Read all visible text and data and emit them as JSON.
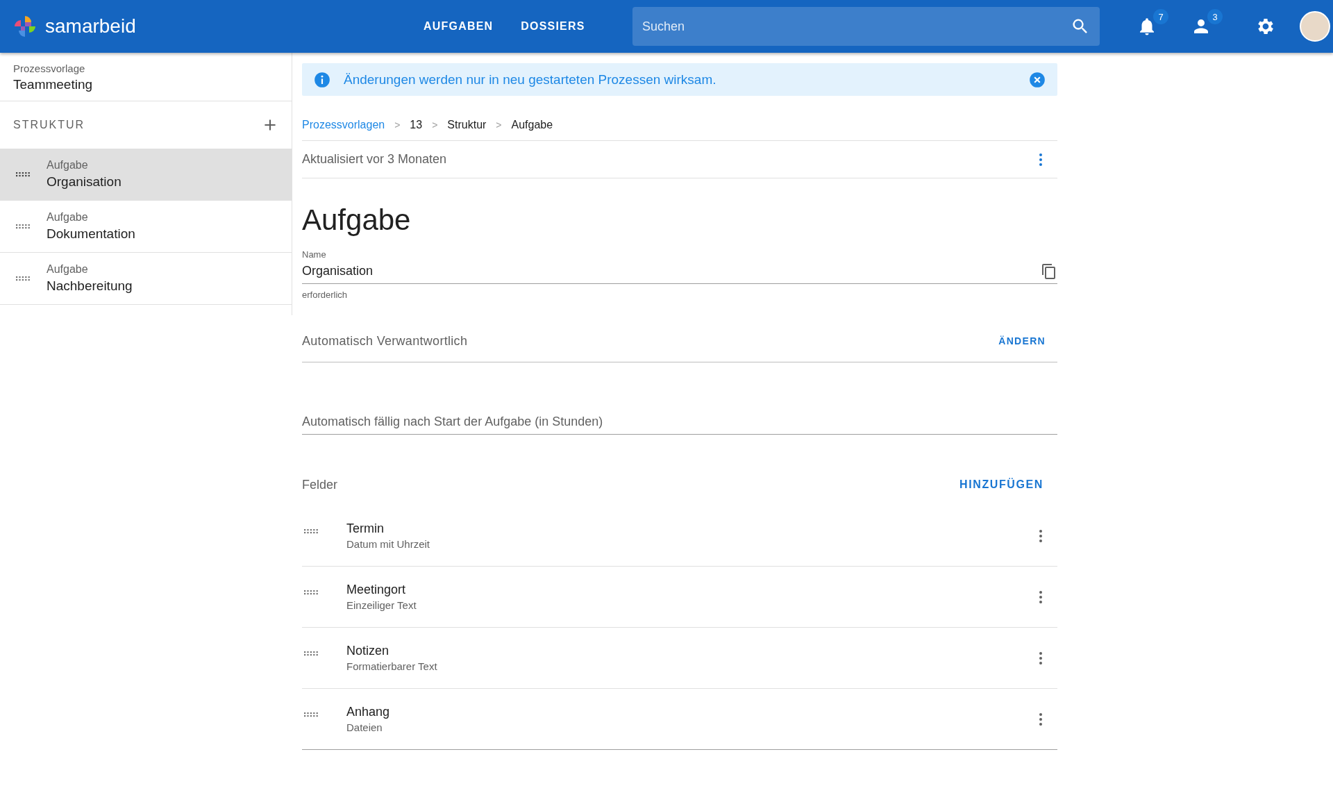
{
  "header": {
    "logo": "samarbeid",
    "nav": [
      {
        "label": "AUFGABEN"
      },
      {
        "label": "DOSSIERS"
      }
    ],
    "search": {
      "placeholder": "Suchen"
    },
    "notifications_count": "7",
    "users_count": "3"
  },
  "sidebar": {
    "caption": "Prozessvorlage",
    "title": "Teammeeting",
    "section": "STRUKTUR",
    "items": [
      {
        "type": "Aufgabe",
        "name": "Organisation",
        "selected": true
      },
      {
        "type": "Aufgabe",
        "name": "Dokumentation",
        "selected": false
      },
      {
        "type": "Aufgabe",
        "name": "Nachbereitung",
        "selected": false
      }
    ]
  },
  "main": {
    "banner": "Änderungen werden nur in neu gestarteten Prozessen wirksam.",
    "breadcrumb": [
      {
        "kind": "link",
        "label": "Prozessvorlagen"
      },
      {
        "kind": "separator",
        "label": ">"
      },
      {
        "kind": "text",
        "label": "13"
      },
      {
        "kind": "separator",
        "label": ">"
      },
      {
        "kind": "text",
        "label": "Struktur"
      },
      {
        "kind": "separator",
        "label": ">"
      },
      {
        "kind": "text",
        "label": "Aufgabe"
      }
    ],
    "updated": "Aktualisiert vor 3 Monaten",
    "title": "Aufgabe",
    "name_field": {
      "label": "Name",
      "value": "Organisation",
      "hint": "erforderlich"
    },
    "responsible": {
      "label": "Automatisch Verwantwortlich",
      "action": "ÄNDERN"
    },
    "due_field": {
      "placeholder": "Automatisch fällig nach Start der Aufgabe (in Stunden)"
    },
    "fields": {
      "title": "Felder",
      "action": "HINZUFÜGEN",
      "items": [
        {
          "name": "Termin",
          "type": "Datum mit Uhrzeit"
        },
        {
          "name": "Meetingort",
          "type": "Einzeiliger Text"
        },
        {
          "name": "Notizen",
          "type": "Formatierbarer Text"
        },
        {
          "name": "Anhang",
          "type": "Dateien"
        }
      ]
    }
  }
}
